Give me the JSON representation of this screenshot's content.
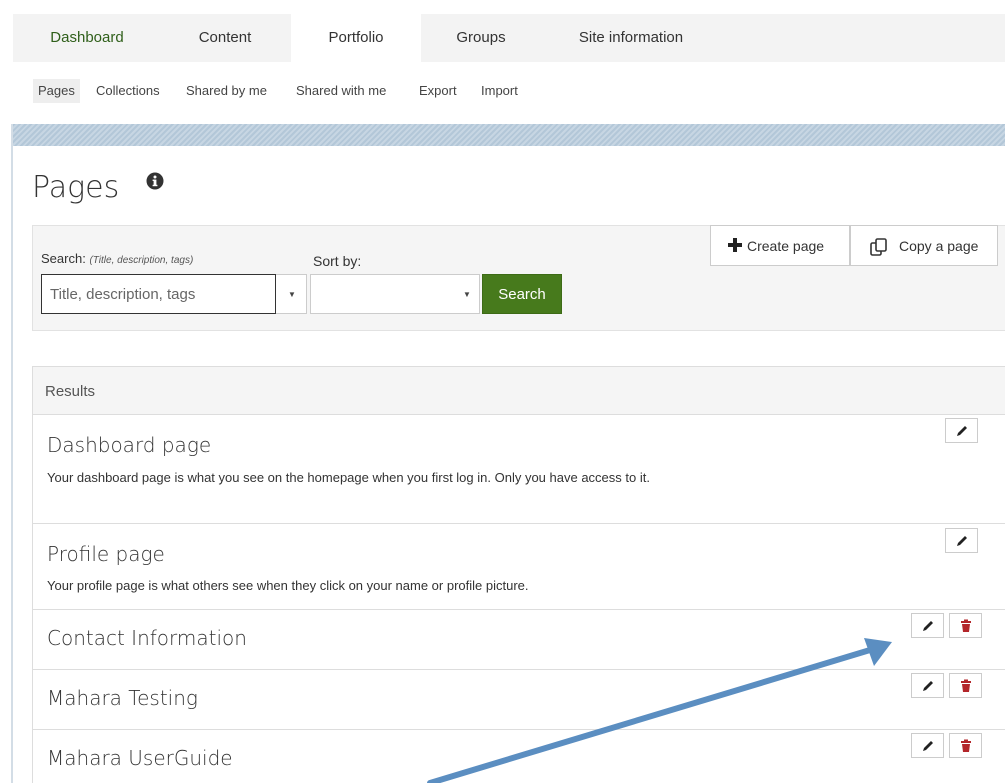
{
  "topnav": {
    "tabs": [
      {
        "label": "Dashboard"
      },
      {
        "label": "Content"
      },
      {
        "label": "Portfolio"
      },
      {
        "label": "Groups"
      },
      {
        "label": "Site information"
      }
    ],
    "active": "Portfolio"
  },
  "subnav": {
    "items": [
      {
        "label": "Pages"
      },
      {
        "label": "Collections"
      },
      {
        "label": "Shared by me"
      },
      {
        "label": "Shared with me"
      },
      {
        "label": "Export"
      },
      {
        "label": "Import"
      }
    ],
    "active": "Pages"
  },
  "page": {
    "title": "Pages",
    "info_icon": "info-circle-icon"
  },
  "search": {
    "label": "Search:",
    "hint": "(Title, description, tags)",
    "placeholder": "Title, description, tags",
    "value": "",
    "sort_label": "Sort by:",
    "sort_value": "",
    "button_label": "Search"
  },
  "actions": {
    "create_label": "Create page",
    "copy_label": "Copy a page"
  },
  "results": {
    "header": "Results",
    "items": [
      {
        "title": "Dashboard page",
        "description": "Your dashboard page is what you see on the homepage when you first log in. Only you have access to it.",
        "can_delete": false
      },
      {
        "title": "Profile page",
        "description": "Your profile page is what others see when they click on your name or profile picture.",
        "can_delete": false
      },
      {
        "title": "Contact Information",
        "description": "",
        "can_delete": true
      },
      {
        "title": "Mahara Testing",
        "description": "",
        "can_delete": true
      },
      {
        "title": "Mahara UserGuide",
        "description": "",
        "can_delete": true
      }
    ]
  },
  "colors": {
    "accent_green": "#477a1c",
    "delete_red": "#b3262a",
    "arrow_blue": "#5b8ec1"
  }
}
